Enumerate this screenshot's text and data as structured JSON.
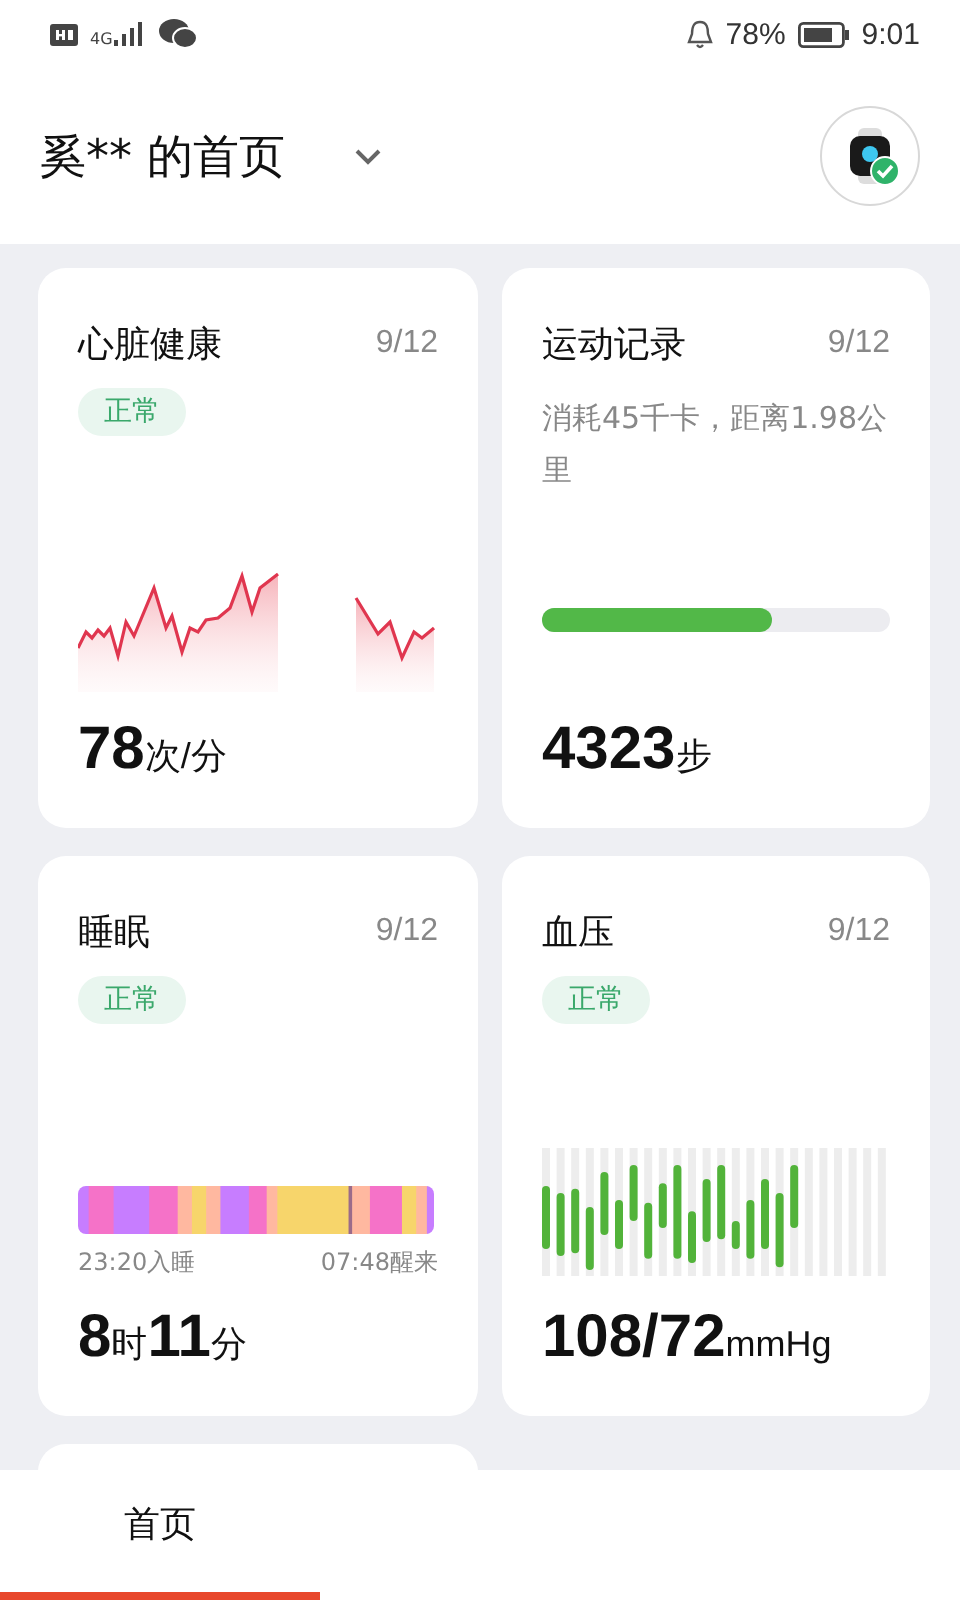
{
  "status_bar": {
    "network": "4G",
    "battery": "78%",
    "time": "9:01"
  },
  "header": {
    "title": "奚** 的首页"
  },
  "cards": [
    {
      "kind": "heart",
      "title": "心脏健康",
      "date": "9/12",
      "badge": "正常",
      "value_parts": [
        {
          "text": "78",
          "kind": "number"
        },
        {
          "text": "次/分",
          "kind": "unit"
        }
      ]
    },
    {
      "kind": "exercise",
      "title": "运动记录",
      "date": "9/12",
      "description": "消耗45千卡，距离1.98公里",
      "level": 0.66,
      "value_parts": [
        {
          "text": "4323",
          "kind": "number"
        },
        {
          "text": "步",
          "kind": "unit"
        }
      ]
    },
    {
      "kind": "sleep",
      "title": "睡眠",
      "date": "9/12",
      "badge": "正常",
      "sleep_start": "23:20入睡",
      "wake": "07:48醒来",
      "value_parts": [
        {
          "text": "8",
          "kind": "number"
        },
        {
          "text": "时",
          "kind": "unit"
        },
        {
          "text": "11",
          "kind": "number"
        },
        {
          "text": "分",
          "kind": "unit"
        }
      ]
    },
    {
      "kind": "blood_pressure",
      "title": "血压",
      "date": "9/12",
      "badge": "正常",
      "value_parts": [
        {
          "text": "108/72",
          "kind": "number"
        },
        {
          "text": "mmHg",
          "kind": "unit"
        }
      ]
    }
  ],
  "nav": [
    {
      "label": "首页",
      "selected": true
    }
  ]
}
